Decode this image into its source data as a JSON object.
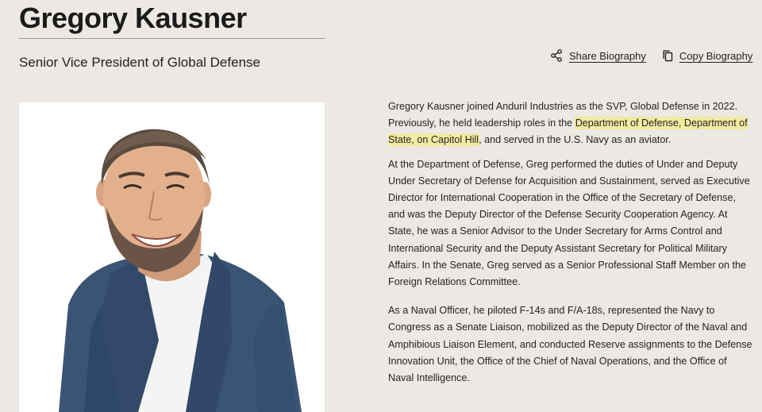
{
  "profile": {
    "name": "Gregory Kausner",
    "title": "Senior Vice President of Global Defense"
  },
  "actions": {
    "share": {
      "label": "Share Biography",
      "icon": "share-icon"
    },
    "copy": {
      "label": "Copy Biography",
      "icon": "copy-icon"
    }
  },
  "edge_glyph": "(",
  "photo": {
    "subject": "portrait",
    "colors": {
      "background": "#ffffff",
      "blazer": "#3b5474",
      "shirt": "#f4f4f4"
    }
  },
  "bio": {
    "highlight_color": "#f3eaa2",
    "p1": {
      "before": "Gregory Kausner joined Anduril Industries as the SVP, Global Defense in 2022. Previously, he held leadership roles in the ",
      "highlight": "Department of Defense, Department of State, on Capitol Hill",
      "after": ", and served in the U.S. Navy as an aviator."
    },
    "p2": "At the Department of Defense, Greg performed the duties of Under and Deputy Under Secretary of Defense for Acquisition and Sustainment, served as Executive Director for International Cooperation in the Office of the Secretary of Defense, and was the Deputy Director of the Defense Security Cooperation Agency. At State, he was a Senior Advisor to the Under Secretary for Arms Control and International Security and the Deputy Assistant Secretary for Political Military Affairs. In the Senate, Greg served as a Senior Professional Staff Member on the Foreign Relations Committee.",
    "p3": "As a Naval Officer, he piloted F-14s and F/A-18s, represented the Navy to Congress as a Senate Liaison, mobilized as the Deputy Director of the Naval and Amphibious Liaison Element, and conducted Reserve assignments to the Defense Innovation Unit, the Office of the Chief of Naval Operations, and the Office of Naval Intelligence."
  }
}
